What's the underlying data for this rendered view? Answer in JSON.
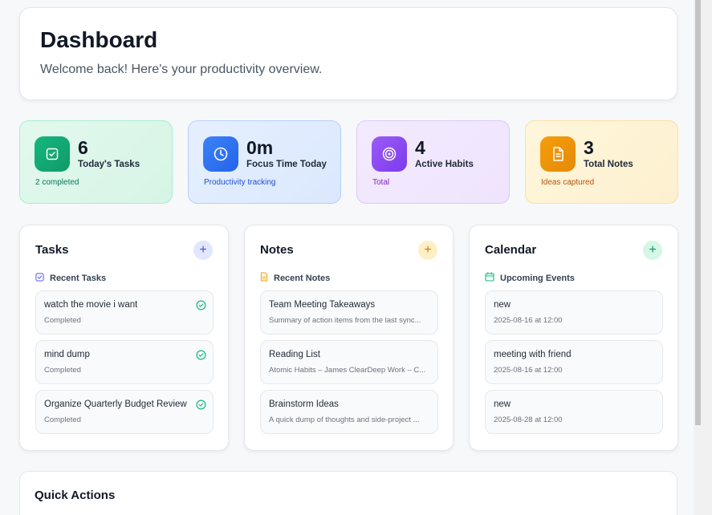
{
  "header": {
    "title": "Dashboard",
    "subtitle": "Welcome back! Here's your productivity overview."
  },
  "stats": [
    {
      "value": "6",
      "label": "Today's Tasks",
      "sub": "2 completed",
      "icon": "checkbox-icon"
    },
    {
      "value": "0m",
      "label": "Focus Time Today",
      "sub": "Productivity tracking",
      "icon": "clock-icon"
    },
    {
      "value": "4",
      "label": "Active Habits",
      "sub": "Total",
      "icon": "target-icon"
    },
    {
      "value": "3",
      "label": "Total Notes",
      "sub": "Ideas captured",
      "icon": "document-icon"
    }
  ],
  "tasks": {
    "title": "Tasks",
    "add": "+",
    "sub_label": "Recent Tasks",
    "items": [
      {
        "title": "watch the movie i want",
        "sub": "Completed"
      },
      {
        "title": "mind dump",
        "sub": "Completed"
      },
      {
        "title": "Organize Quarterly Budget Review",
        "sub": "Completed"
      }
    ]
  },
  "notes": {
    "title": "Notes",
    "add": "+",
    "sub_label": "Recent Notes",
    "items": [
      {
        "title": "Team Meeting Takeaways",
        "sub": "Summary of action items from the last sync..."
      },
      {
        "title": "Reading List",
        "sub": "Atomic Habits – James ClearDeep Work – C..."
      },
      {
        "title": "Brainstorm Ideas",
        "sub": "A quick dump of thoughts and side-project ..."
      }
    ]
  },
  "calendar": {
    "title": "Calendar",
    "add": "+",
    "sub_label": "Upcoming Events",
    "items": [
      {
        "title": "new",
        "sub": "2025-08-16 at 12:00"
      },
      {
        "title": "meeting with friend",
        "sub": "2025-08-16 at 12:00"
      },
      {
        "title": "new",
        "sub": "2025-08-28 at 12:00"
      }
    ]
  },
  "quick_actions": {
    "title": "Quick Actions"
  },
  "colors": {
    "green": "#10b981",
    "blue": "#3b82f6",
    "purple": "#8b5cf6",
    "orange": "#f59e0b"
  }
}
